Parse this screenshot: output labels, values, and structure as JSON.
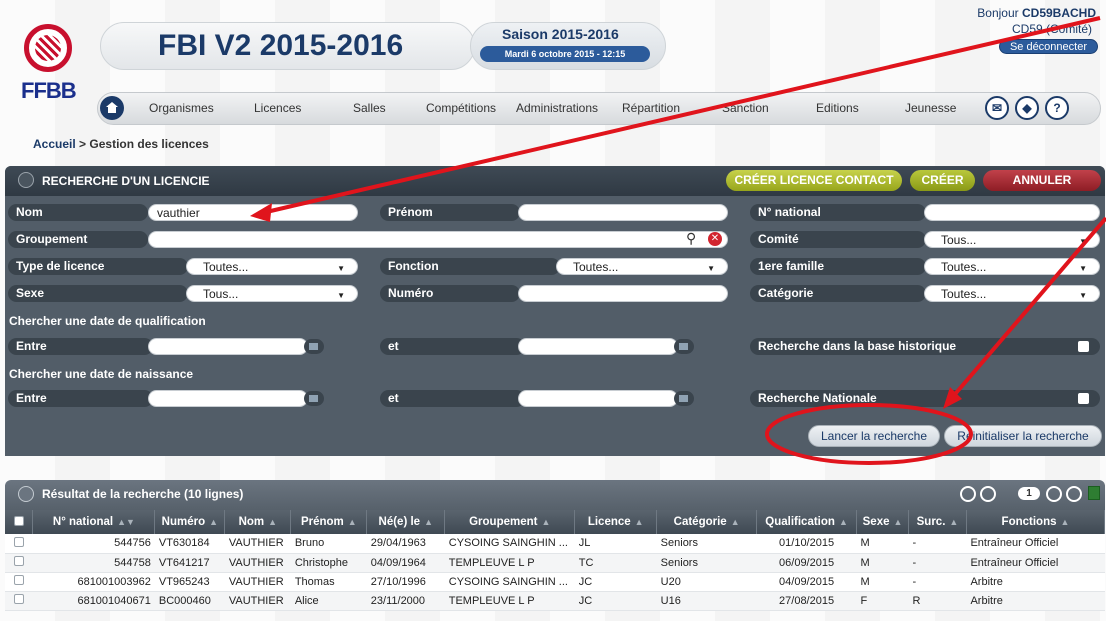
{
  "header": {
    "logo_text": "FFBB",
    "app_title": "FBI V2 2015-2016",
    "season": "Saison 2015-2016",
    "date": "Mardi 6 octobre 2015 - 12:15",
    "greeting_prefix": "Bonjour",
    "user": "CD59BACHD",
    "org": "CD59 (Comité)",
    "logout": "Se déconnecter"
  },
  "nav": {
    "items": [
      "Organismes",
      "Licences",
      "Salles",
      "Compétitions",
      "Administrations",
      "Répartition",
      "Sanction",
      "Editions",
      "Jeunesse"
    ],
    "icons": [
      "mail-icon",
      "book-icon",
      "help-icon"
    ],
    "help_glyph": "?"
  },
  "breadcrumb": {
    "home": "Accueil",
    "sep": ">",
    "current": "Gestion des licences"
  },
  "search": {
    "title": "RECHERCHE D'UN LICENCIE",
    "btn_contact": "CRÉER LICENCE CONTACT",
    "btn_create": "CRÉER",
    "btn_cancel": "ANNULER",
    "nom_label": "Nom",
    "nom_value": "vauthier",
    "prenom_label": "Prénom",
    "national_label": "N° national",
    "groupement_label": "Groupement",
    "comite_label": "Comité",
    "comite_value": "Tous...",
    "type_label": "Type de licence",
    "type_value": "Toutes...",
    "fonction_label": "Fonction",
    "fonction_value": "Toutes...",
    "famille_label": "1ere famille",
    "famille_value": "Toutes...",
    "sexe_label": "Sexe",
    "sexe_value": "Tous...",
    "numero_label": "Numéro",
    "categorie_label": "Catégorie",
    "categorie_value": "Toutes...",
    "qualif_heading": "Chercher une date de qualification",
    "entre_label": "Entre",
    "et_label": "et",
    "historique_label": "Recherche dans la base historique",
    "naissance_heading": "Chercher une date de naissance",
    "nationale_label": "Recherche Nationale",
    "launch": "Lancer la recherche",
    "reset": "Réinitialiser la recherche"
  },
  "results": {
    "title": "Résultat de la recherche (10 lignes)",
    "page": "1",
    "columns": [
      "N° national",
      "Numéro",
      "Nom",
      "Prénom",
      "Né(e) le",
      "Groupement",
      "Licence",
      "Catégorie",
      "Qualification",
      "Sexe",
      "Surc.",
      "Fonctions"
    ],
    "rows": [
      [
        "544756",
        "VT630184",
        "VAUTHIER",
        "Bruno",
        "29/04/1963",
        "CYSOING SAINGHIN ...",
        "JL",
        "Seniors",
        "01/10/2015",
        "M",
        "-",
        "Entraîneur Officiel"
      ],
      [
        "544758",
        "VT641217",
        "VAUTHIER",
        "Christophe",
        "04/09/1964",
        "TEMPLEUVE L P",
        "TC",
        "Seniors",
        "06/09/2015",
        "M",
        "-",
        "Entraîneur Officiel"
      ],
      [
        "681001003962",
        "VT965243",
        "VAUTHIER",
        "Thomas",
        "27/10/1996",
        "CYSOING SAINGHIN ...",
        "JC",
        "U20",
        "04/09/2015",
        "M",
        "-",
        "Arbitre"
      ],
      [
        "681001040671",
        "BC000460",
        "VAUTHIER",
        "Alice",
        "23/11/2000",
        "TEMPLEUVE L P",
        "JC",
        "U16",
        "27/08/2015",
        "F",
        "R",
        "Arbitre"
      ]
    ]
  },
  "colors": {
    "brand_blue": "#1b3a68",
    "brand_red": "#c8102e",
    "panel": "#525d68",
    "annotation": "#e0141c"
  }
}
